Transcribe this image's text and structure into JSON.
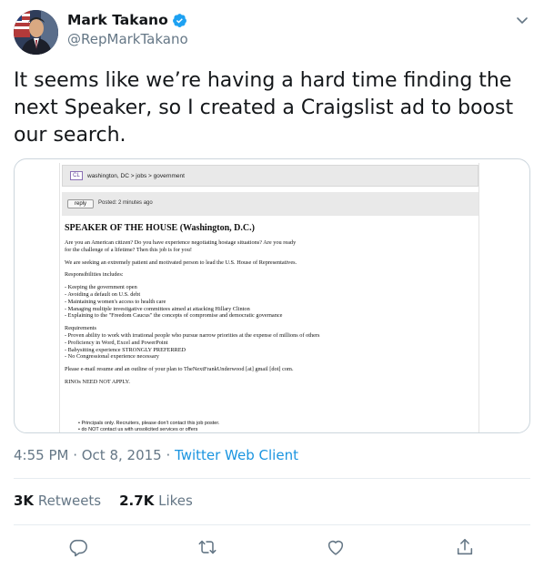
{
  "author": {
    "display_name": "Mark Takano",
    "handle": "@RepMarkTakano",
    "verified": true
  },
  "tweet_text": "It seems like we’re having a hard time finding the next Speaker, so I created a Craigslist ad to boost our search.",
  "media": {
    "breadcrumb": "washington, DC > jobs > government",
    "logo": "CL",
    "reply_label": "reply",
    "posted": "Posted: 2 minutes ago",
    "title": "SPEAKER OF THE HOUSE (Washington, D.C.)",
    "intro_1": "Are you an American citizen? Do you have experience negotiating hostage situations? Are you ready",
    "intro_2": "for the challenge of a lifetime? Then this job is for you!",
    "seeking": "We are seeking an extremely patient and motivated person to lead the U.S. House of Representatives.",
    "resp_header": "Responsibilities includes:",
    "resp": [
      "- Keeping the government open",
      "- Avoiding a default on U.S. debt",
      "- Maintaining women's access to health care",
      "- Managing multiple investigative committees aimed at attacking Hillary Clinton",
      "- Explaining to the \"Freedom Caucus\" the concepts of compromise and democratic governance"
    ],
    "req_header": "Requirements",
    "req": [
      "- Proven ability to work with irrational people who pursue narrow priorities at the expense of millions of others",
      "- Proficiency in Word, Excel and PowerPoint",
      "- Babysitting experience STRONGLY PREFERRED",
      "- No Congressional experience necessary"
    ],
    "email": "Please e-mail resume and an outline of your plan to TheNextFrankUnderwood [at] gmail [dot] com.",
    "rinos": "RINOs NEED NOT APPLY.",
    "foot_1": "•  Principals only. Recruiters, please don't contact this job poster.",
    "foot_2": "•  do NOT contact us with unsolicited services or offers"
  },
  "meta": {
    "time": "4:55 PM · Oct 8, 2015 · ",
    "source": "Twitter Web Client"
  },
  "stats": {
    "retweets_count": "3K",
    "retweets_label": "Retweets",
    "likes_count": "2.7K",
    "likes_label": "Likes"
  },
  "colors": {
    "accent": "#1b95e0",
    "verified": "#1da1f2",
    "muted": "#657786"
  },
  "icons": [
    "verified-badge-icon",
    "chevron-down-icon",
    "reply-icon",
    "retweet-icon",
    "like-icon",
    "share-icon"
  ]
}
